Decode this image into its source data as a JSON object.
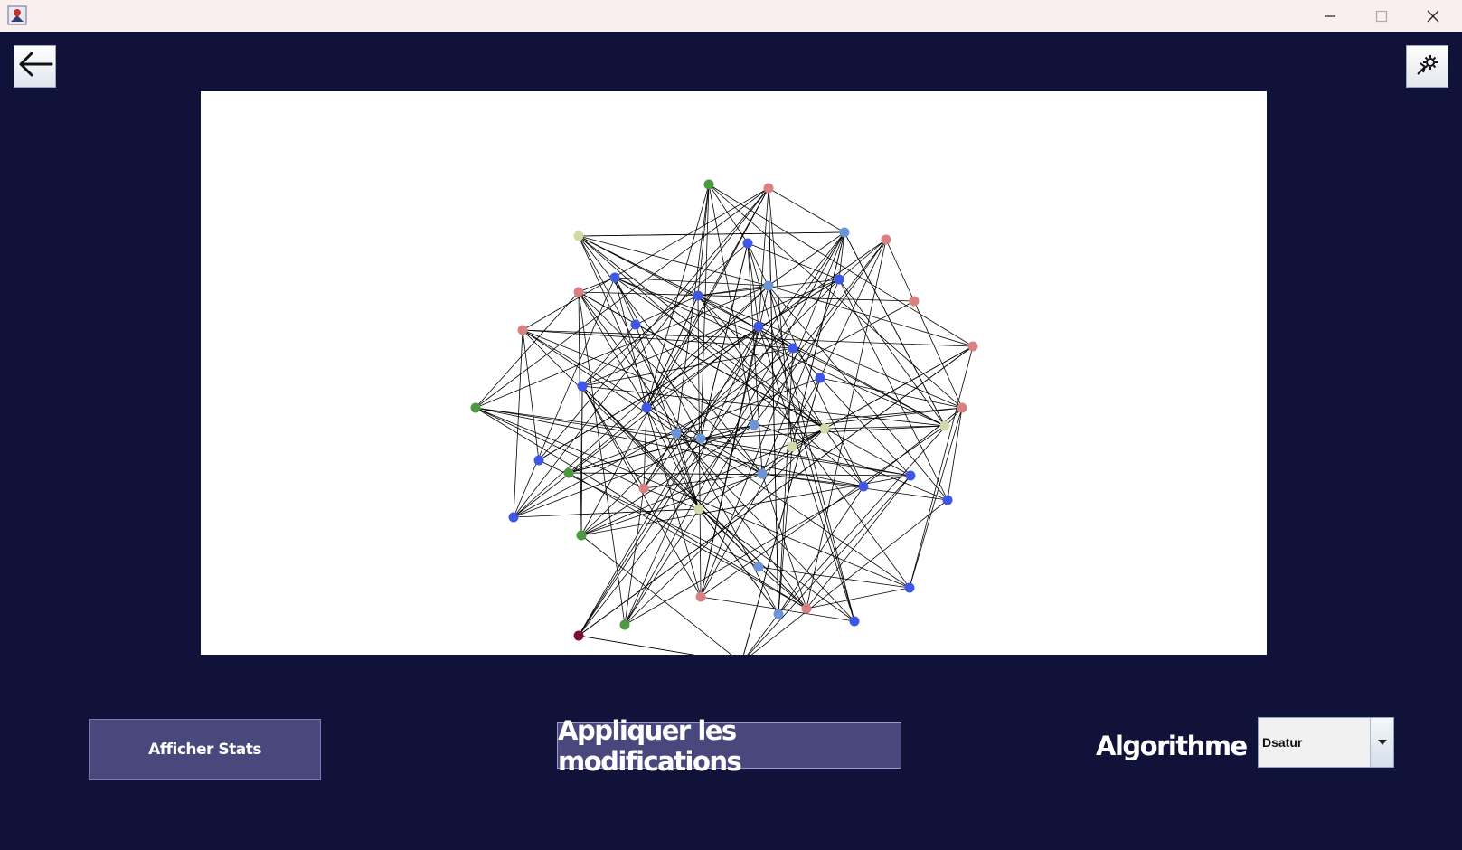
{
  "window": {
    "app_icon": "java-app-icon",
    "controls": [
      "minimize-icon",
      "maximize-icon",
      "close-icon"
    ]
  },
  "toolbar": {
    "back_icon": "arrow-left-icon",
    "settings_icon": "gear-icon"
  },
  "graph": {
    "node_colors": {
      "green": "#4c9a3e",
      "pink": "#d98080",
      "blue": "#3f57e6",
      "light_blue": "#6a96d8",
      "pale_yellow": "#d3d9a6",
      "dark_red": "#7a0f2a"
    }
  },
  "actions": {
    "stats_label": "Afficher Stats",
    "apply_label": "Appliquer les modifications"
  },
  "algorithm": {
    "label": "Algorithme",
    "selected": "Dsatur",
    "arrow_icon": "chevron-down-icon"
  },
  "colors": {
    "background": "#11123a",
    "button_fill": "#48487d"
  }
}
